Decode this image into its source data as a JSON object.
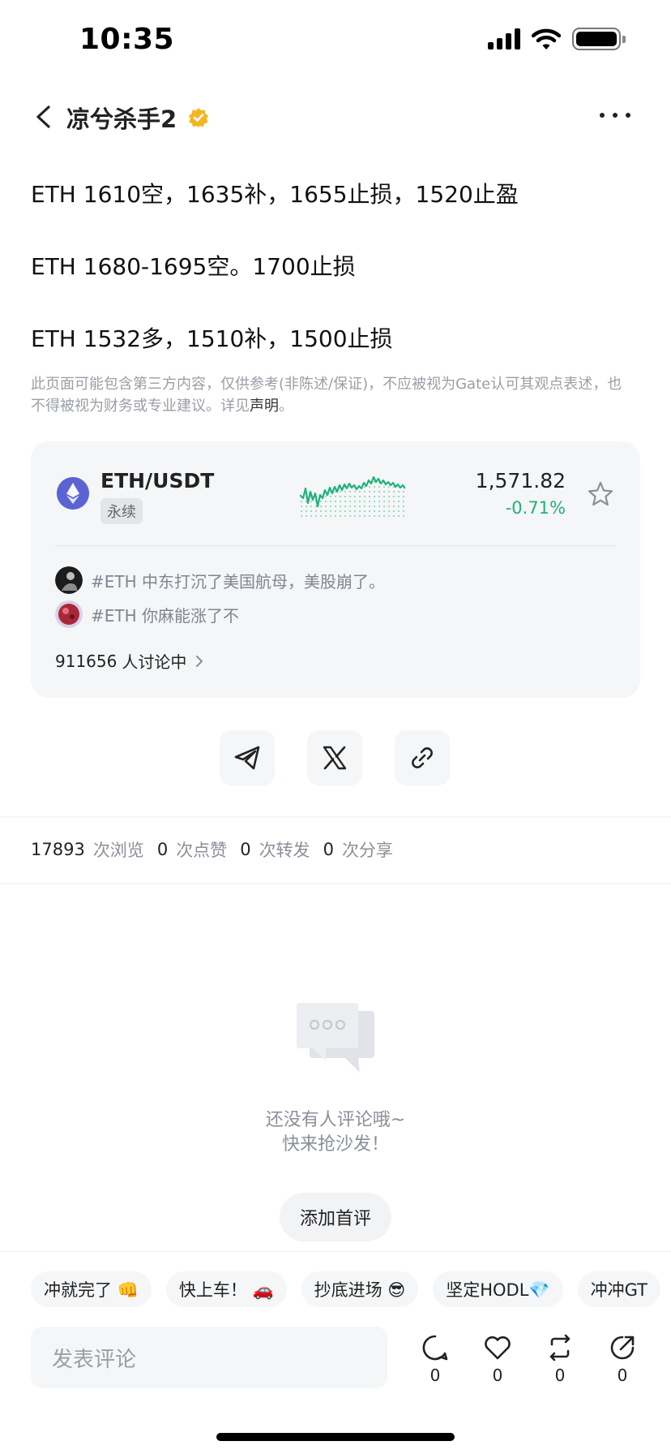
{
  "status_bar": {
    "time": "10:35",
    "icons": [
      "signal-icon",
      "wifi-icon",
      "battery-icon"
    ]
  },
  "header": {
    "author": "凉兮杀手2",
    "back_icon": "chevron-left-icon",
    "verified_icon": "verified-badge-icon",
    "more_icon": "more-dots-icon"
  },
  "post": {
    "lines": [
      "ETH 1610空，1635补，1655止损，1520止盈",
      "ETH 1680-1695空。1700止损",
      "ETH 1532多，1510补，1500止损"
    ],
    "disclaimer": "此页面可能包含第三方内容，仅供参考(非陈述/保证)，不应被视为Gate认可其观点表述，也不得被视为财务或专业建议。详见",
    "disclaimer_link": "声明",
    "disclaimer_end": "。"
  },
  "market_card": {
    "pair": "ETH/USDT",
    "contract_type": "永续",
    "price": "1,571.82",
    "change": "-0.71%",
    "change_color": "#1fb37a",
    "discussions": [
      {
        "text": "#ETH 中东打沉了美国航母，美股崩了。"
      },
      {
        "text": "#ETH 你麻能涨了不"
      }
    ],
    "discussing_count": "911656",
    "discussing_label": "人讨论中"
  },
  "share": {
    "buttons": [
      "telegram-icon",
      "x-icon",
      "link-icon"
    ]
  },
  "stats": {
    "views": "17893",
    "views_label": "次浏览",
    "likes": "0",
    "likes_label": "次点赞",
    "reposts": "0",
    "reposts_label": "次转发",
    "shares": "0",
    "shares_label": "次分享"
  },
  "comments_empty": {
    "line1": "还没有人评论哦~",
    "line2": "快来抢沙发！",
    "button": "添加首评"
  },
  "quick_replies": [
    "冲就完了 👊",
    "快上车！ 🚗",
    "抄底进场 😎",
    "坚定HODL💎",
    "冲冲GT"
  ],
  "comment_input": {
    "placeholder": "发表评论"
  },
  "actions": [
    {
      "icon": "comment-icon",
      "count": "0"
    },
    {
      "icon": "heart-icon",
      "count": "0"
    },
    {
      "icon": "repost-icon",
      "count": "0"
    },
    {
      "icon": "share-icon",
      "count": "0"
    }
  ],
  "colors": {
    "accent_green": "#1fb37a",
    "card_bg": "#f4f6f8",
    "eth_purple": "#5b63d3",
    "verified_gold": "#f3b623"
  }
}
